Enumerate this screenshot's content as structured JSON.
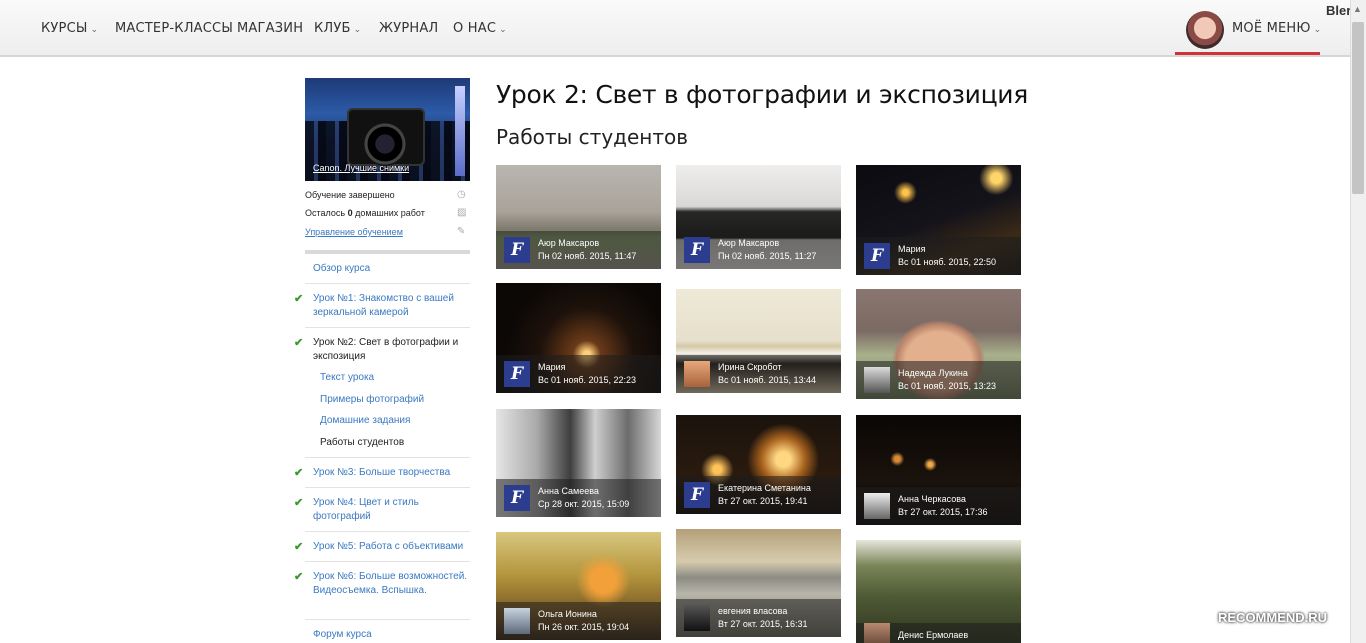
{
  "brand": "Blerry",
  "nav": {
    "items": [
      {
        "label": "КУРСЫ",
        "dropdown": true
      },
      {
        "label": "МАСТЕР-КЛАССЫ",
        "dropdown": false
      },
      {
        "label": "МАГАЗИН",
        "dropdown": false
      },
      {
        "label": "КЛУБ",
        "dropdown": true
      },
      {
        "label": "ЖУРНАЛ",
        "dropdown": false
      },
      {
        "label": "О НАС",
        "dropdown": true
      }
    ],
    "my_menu": "МОЁ МЕНЮ",
    "chevron": "⌄"
  },
  "sidebar": {
    "course_title": "Canon. Лучшие снимки",
    "status": "Обучение завершено",
    "homework_prefix": "Осталось ",
    "homework_count": "0",
    "homework_suffix": " домашних работ",
    "manage_link": "Управление обучением",
    "overview": "Обзор курса",
    "lessons": [
      {
        "label": "Урок №1: Знакомство с вашей зеркальной камерой",
        "done": true
      },
      {
        "label": "Урок №2: Свет в фотографии и экспозиция",
        "done": true,
        "current": true
      },
      {
        "label": "Урок №3: Больше творчества",
        "done": true
      },
      {
        "label": "Урок №4: Цвет и стиль фотографий",
        "done": true
      },
      {
        "label": "Урок №5: Работа с объективами",
        "done": true
      },
      {
        "label": "Урок №6: Больше возможностей. Видеосъемка. Вспышка.",
        "done": true
      }
    ],
    "sub_items": [
      "Текст урока",
      "Примеры фотографий",
      "Домашние задания",
      "Работы студентов"
    ],
    "forum": "Форум курса",
    "check_icon": "check-icon"
  },
  "main": {
    "title": "Урок 2: Свет в фотографии и экспозиция",
    "subtitle": "Работы студентов",
    "works": [
      {
        "name": "Аюр Максаров",
        "date": "Пн 02 нояб. 2015, 11:47",
        "avatar": "logo"
      },
      {
        "name": "Аюр Максаров",
        "date": "Пн 02 нояб. 2015, 11:27",
        "avatar": "logo"
      },
      {
        "name": "Мария",
        "date": "Вс 01 нояб. 2015, 22:50",
        "avatar": "logo"
      },
      {
        "name": "Мария",
        "date": "Вс 01 нояб. 2015, 22:23",
        "avatar": "logo"
      },
      {
        "name": "Ирина Скробот",
        "date": "Вс 01 нояб. 2015, 13:44",
        "avatar": "photo"
      },
      {
        "name": "Надежда Лукина",
        "date": "Вс 01 нояб. 2015, 13:23",
        "avatar": "photo"
      },
      {
        "name": "Анна Самеева",
        "date": "Ср 28 окт. 2015, 15:09",
        "avatar": "logo"
      },
      {
        "name": "Екатерина Сметанина",
        "date": "Вт 27 окт. 2015, 19:41",
        "avatar": "logo"
      },
      {
        "name": "Анна Черкасова",
        "date": "Вт 27 окт. 2015, 17:36",
        "avatar": "photo"
      },
      {
        "name": "Ольга Ионина",
        "date": "Пн 26 окт. 2015, 19:04",
        "avatar": "photo"
      },
      {
        "name": "евгения власова",
        "date": "Вт 27 окт. 2015, 16:31",
        "avatar": "photo"
      },
      {
        "name": "Денис Ермолаев",
        "date": "",
        "avatar": "photo"
      }
    ],
    "logo_letter": "F"
  },
  "watermark": "RECOMMEND.RU"
}
